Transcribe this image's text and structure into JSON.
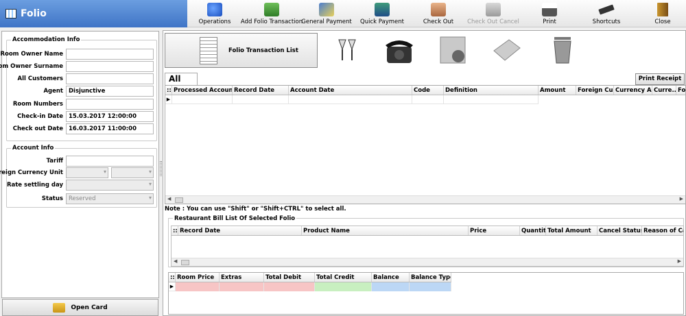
{
  "window": {
    "title": "Folio"
  },
  "toolbar": [
    {
      "label": "Operations",
      "icon": "operations-icon",
      "enabled": true
    },
    {
      "label": "Add Folio Transaction",
      "icon": "add-money-icon",
      "enabled": true
    },
    {
      "label": "General Payment",
      "icon": "payment-icon",
      "enabled": true
    },
    {
      "label": "Quick Payment",
      "icon": "card-reader-icon",
      "enabled": true
    },
    {
      "label": "Check Out",
      "icon": "handshake-icon",
      "enabled": true
    },
    {
      "label": "Check Out Cancel",
      "icon": "handshake-cancel-icon",
      "enabled": false
    },
    {
      "label": "Print",
      "icon": "printer-icon",
      "enabled": true
    },
    {
      "label": "Shortcuts",
      "icon": "keyboard-icon",
      "enabled": true
    },
    {
      "label": "Close",
      "icon": "exit-door-icon",
      "enabled": true
    }
  ],
  "accommodation": {
    "title": "Accommodation Info",
    "fields": [
      {
        "label": "Room Owner Name",
        "value": ""
      },
      {
        "label": "Room Owner Surname",
        "value": ""
      },
      {
        "label": "All Customers",
        "value": ""
      },
      {
        "label": "Agent",
        "value": "Disjunctive"
      },
      {
        "label": "Room Numbers",
        "value": ""
      },
      {
        "label": "Check-in Date",
        "value": "15.03.2017 12:00:00"
      },
      {
        "label": "Check out Date",
        "value": "16.03.2017 11:00:00"
      }
    ]
  },
  "account": {
    "title": "Account Info",
    "tariff_label": "Tariff",
    "tariff_value": "",
    "currency_label": "Foreign Currency Unit",
    "rate_label": "Rate settling day",
    "status_label": "Status",
    "status_value": "Reserved"
  },
  "open_card": "Open Card",
  "folio_tabs": {
    "active_label": "Folio Transaction List",
    "icons": [
      "drinks-icon",
      "telephone-icon",
      "minibar-icon",
      "laundry-icon",
      "trash-icon"
    ]
  },
  "transactions": {
    "tab": "All",
    "print_receipt": "Print Receipt",
    "columns": [
      "Processed Account",
      "Record Date",
      "Account Date",
      "Code",
      "Definition",
      "Amount",
      "Foreign Cu...",
      "Currency A...",
      "Curre...",
      "For"
    ]
  },
  "note": "Note : You can use \"Shift\" or \"Shift+CTRL\" to select all.",
  "restaurant": {
    "title": "Restaurant Bill List Of Selected Folio",
    "columns": [
      "Record Date",
      "Product Name",
      "Price",
      "Quantity",
      "Total Amount",
      "Cancel Status",
      "Reason of Car"
    ]
  },
  "totals": {
    "columns": [
      "Room Price",
      "Extras",
      "Total Debit",
      "Total Credit",
      "Balance",
      "Balance Type"
    ],
    "colors": {
      "Room Price": "#f7c5c5",
      "Extras": "#f7c5c5",
      "Total Debit": "#f7c5c5",
      "Total Credit": "#c8efc0",
      "Balance": "#bcd7f5",
      "Balance Type": "#bcd7f5"
    }
  }
}
